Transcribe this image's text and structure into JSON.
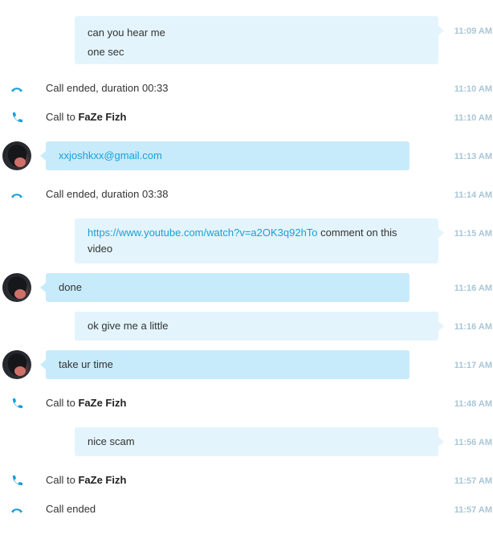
{
  "messages": [
    {
      "kind": "out",
      "lines": [
        "can you hear me",
        "one sec"
      ],
      "time": "11:09 AM"
    },
    {
      "kind": "call_end",
      "text": "Call ended, duration 00:33",
      "time": "11:10 AM"
    },
    {
      "kind": "call_to",
      "prefix": "Call to ",
      "name": "FaZe Fizh",
      "time": "11:10 AM"
    },
    {
      "kind": "in",
      "text": "xxjoshkxx@gmail.com",
      "time": "11:13 AM"
    },
    {
      "kind": "call_end",
      "text": "Call ended, duration 03:38",
      "time": "11:14 AM"
    },
    {
      "kind": "out_link",
      "link": "https://www.youtube.com/watch?v=a2OK3q92hTo",
      "after": " comment on this",
      "line2": "video",
      "time": "11:15 AM"
    },
    {
      "kind": "in",
      "text": "done",
      "time": "11:16 AM"
    },
    {
      "kind": "out",
      "lines": [
        "ok give me a little"
      ],
      "time": "11:16 AM"
    },
    {
      "kind": "in",
      "text": "take ur time",
      "time": "11:17 AM"
    },
    {
      "kind": "call_to",
      "prefix": "Call to ",
      "name": "FaZe Fizh",
      "time": "11:48 AM"
    },
    {
      "kind": "out",
      "lines": [
        "nice scam"
      ],
      "time": "11:56 AM"
    },
    {
      "kind": "call_to",
      "prefix": "Call to ",
      "name": "FaZe Fizh",
      "time": "11:57 AM"
    },
    {
      "kind": "call_end",
      "text": "Call ended",
      "time": "11:57 AM"
    }
  ],
  "colors": {
    "accent": "#1a9fd9",
    "incoming_bubble": "#c7ebfb",
    "outgoing_bubble": "#e3f4fc",
    "timestamp": "#a9c6d6"
  }
}
